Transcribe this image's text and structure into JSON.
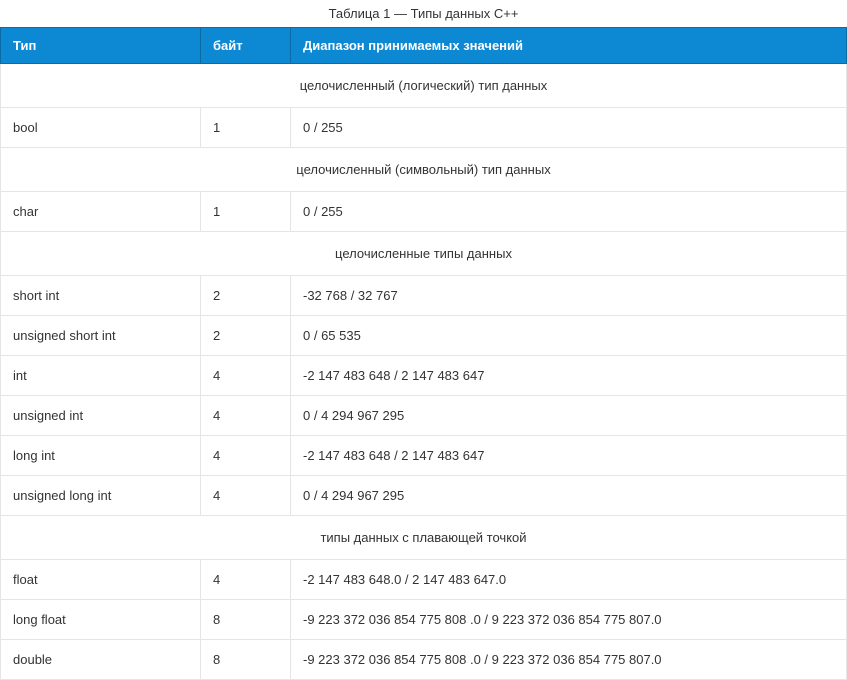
{
  "caption": "Таблица 1 — Типы данных С++",
  "headers": {
    "type": "Тип",
    "bytes": "байт",
    "range": "Диапазон принимаемых значений"
  },
  "sections": [
    {
      "title": "целочисленный (логический) тип данных",
      "rows": [
        {
          "type": "bool",
          "bytes": "1",
          "range": "0   /   255"
        }
      ]
    },
    {
      "title": "целочисленный (символьный) тип данных",
      "rows": [
        {
          "type": "char",
          "bytes": "1",
          "range": "0   /   255"
        }
      ]
    },
    {
      "title": "целочисленные типы данных",
      "rows": [
        {
          "type": "short int",
          "bytes": "2",
          "range": "-32 768    /    32 767"
        },
        {
          "type": "unsigned short int",
          "bytes": "2",
          "range": "0  /  65 535"
        },
        {
          "type": "int",
          "bytes": "4",
          "range": "-2 147 483 648   /   2 147 483 647"
        },
        {
          "type": "unsigned int",
          "bytes": "4",
          "range": "0     /     4 294 967 295"
        },
        {
          "type": "long int",
          "bytes": "4",
          "range": "-2 147 483 648    /    2 147 483 647"
        },
        {
          "type": "unsigned long int",
          "bytes": "4",
          "range": "0     /     4 294 967 295"
        }
      ]
    },
    {
      "title": "типы данных с плавающей точкой",
      "rows": [
        {
          "type": "float",
          "bytes": "4",
          "range": "-2 147 483 648.0  / 2 147 483 647.0"
        },
        {
          "type": "long float",
          "bytes": "8",
          "range": "-9 223 372 036 854 775 808 .0   /   9 223 372 036 854 775 807.0"
        },
        {
          "type": "double",
          "bytes": "8",
          "range": "-9 223 372 036 854 775 808 .0   /   9 223 372 036 854 775 807.0"
        }
      ]
    }
  ]
}
